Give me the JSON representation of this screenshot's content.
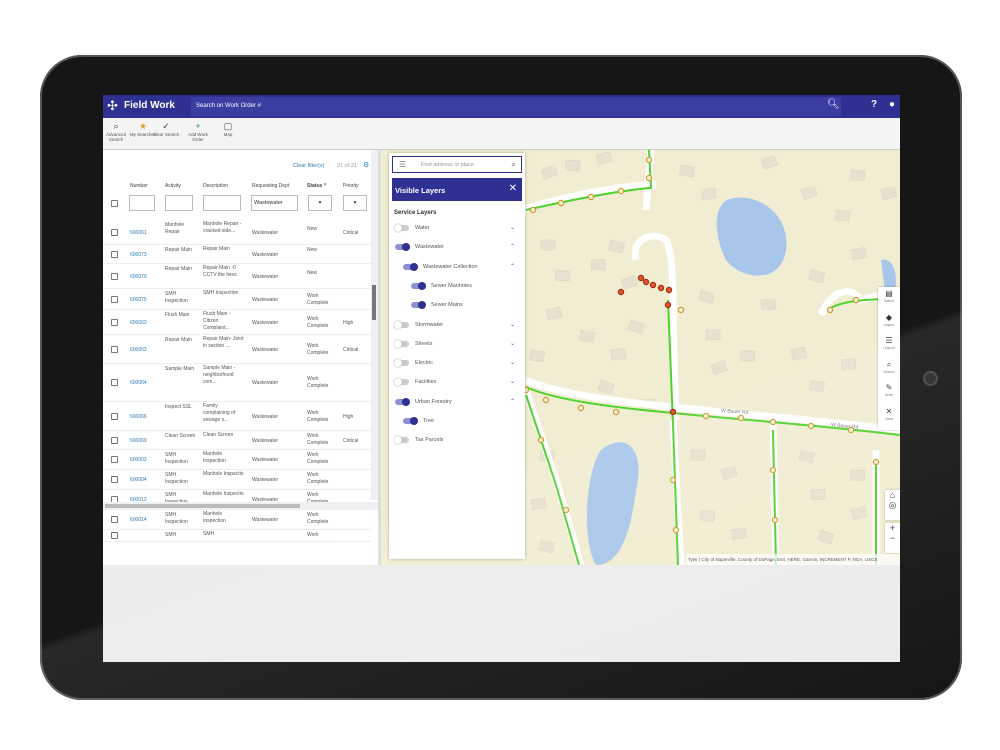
{
  "app": {
    "title": "Field Work",
    "search_placeholder": "Search on Work Order #"
  },
  "toolbar": [
    {
      "label": "Advanced Search",
      "icon": "magnifier-icon"
    },
    {
      "label": "My Searches",
      "icon": "star-icon"
    },
    {
      "label": "Clear Search",
      "icon": "broom-icon"
    },
    {
      "label": "Add Work Order",
      "icon": "plus-icon"
    },
    {
      "label": "Map",
      "icon": "map-icon"
    }
  ],
  "list": {
    "clear_filters": "Clear filter(s)",
    "count": "21 of 21",
    "columns": [
      "Number",
      "Activity",
      "Description",
      "Requesting Dept",
      "Status ^",
      "Priority"
    ],
    "filters": {
      "requesting_dept": "Wastewater"
    },
    "rows": [
      {
        "number": "600061",
        "activity": "Manhole Repair",
        "description": "Manhole Repair - cracked side...",
        "dept": "Wastewater",
        "status": "New",
        "priority": "Critical"
      },
      {
        "number": "600073",
        "activity": "Repair Main",
        "description": "Repair Main",
        "dept": "Wastewater",
        "status": "New",
        "priority": ""
      },
      {
        "number": "600079",
        "activity": "Repair Main",
        "description": "Repair Main -0 CCTV the lines",
        "dept": "Wastewater",
        "status": "New",
        "priority": ""
      },
      {
        "number": "600075",
        "activity": "SMH Inspection",
        "description": "SMH Inspection",
        "dept": "Wastewater",
        "status": "Work Complete",
        "priority": ""
      },
      {
        "number": "600062",
        "activity": "Flush Main",
        "description": "Flush Main - Citizen Complaint...",
        "dept": "Wastewater",
        "status": "Work Complete",
        "priority": "High"
      },
      {
        "number": "600063",
        "activity": "Repair Main",
        "description": "Repair Main- Joint in section ...",
        "dept": "Wastewater",
        "status": "Work Complete",
        "priority": "Critical"
      },
      {
        "number": "600064",
        "activity": "Sample Main",
        "description": "Sample Main - neighborhood com...",
        "dept": "Wastewater",
        "status": "Work Complete",
        "priority": ""
      },
      {
        "number": "600066",
        "activity": "Inspect SSL",
        "description": "Family complaining of sewage s...",
        "dept": "Wastewater",
        "status": "Work Complete",
        "priority": "High"
      },
      {
        "number": "600069",
        "activity": "Clean Screen",
        "description": "Clean Screen",
        "dept": "Wastewater",
        "status": "Work Complete",
        "priority": "Critical"
      },
      {
        "number": "600003",
        "activity": "SMH Inspection",
        "description": "Manhole Inspection",
        "dept": "Wastewater",
        "status": "Work Complete",
        "priority": ""
      },
      {
        "number": "600004",
        "activity": "SMH Inspection",
        "description": "Manhole Inspectio",
        "dept": "Wastewater",
        "status": "Work Complete",
        "priority": ""
      },
      {
        "number": "600012",
        "activity": "SMH Inspection",
        "description": "Manhole Inspectio",
        "dept": "Wastewater",
        "status": "Work Complete",
        "priority": ""
      },
      {
        "number": "600014",
        "activity": "SMH Inspection",
        "description": "Manhole Inspection",
        "dept": "Wastewater",
        "status": "Work Complete",
        "priority": ""
      },
      {
        "number": "",
        "activity": "SMH",
        "description": "SMH",
        "dept": "",
        "status": "Work",
        "priority": ""
      }
    ]
  },
  "layers": {
    "search_placeholder": "Find address or place",
    "title": "Visible Layers",
    "section": "Service Layers",
    "items": [
      {
        "label": "Water",
        "on": false,
        "level": 0,
        "chevron": "down"
      },
      {
        "label": "Wastewater",
        "on": true,
        "level": 0,
        "chevron": "up"
      },
      {
        "label": "Wastewater Collection",
        "on": true,
        "level": 1,
        "chevron": "up"
      },
      {
        "label": "Sewer Manholes",
        "on": true,
        "level": 2,
        "chevron": ""
      },
      {
        "label": "Sewer Mains",
        "on": true,
        "level": 2,
        "chevron": ""
      },
      {
        "label": "Stormwater",
        "on": false,
        "level": 0,
        "chevron": "down"
      },
      {
        "label": "Streets",
        "on": false,
        "level": 0,
        "chevron": "down"
      },
      {
        "label": "Electric",
        "on": false,
        "level": 0,
        "chevron": "down"
      },
      {
        "label": "Facilities",
        "on": false,
        "level": 0,
        "chevron": "down"
      },
      {
        "label": "Urban Forestry",
        "on": true,
        "level": 0,
        "chevron": "up"
      },
      {
        "label": "Tree",
        "on": true,
        "level": 1,
        "chevron": ""
      },
      {
        "label": "Tax Parcels",
        "on": false,
        "level": 0,
        "chevron": ""
      }
    ]
  },
  "map_tools": [
    {
      "label": "Select",
      "icon": "select-icon"
    },
    {
      "label": "Layers",
      "icon": "layers-icon"
    },
    {
      "label": "Legend",
      "icon": "legend-icon"
    },
    {
      "label": "Search",
      "icon": "search-icon"
    },
    {
      "label": "Draw",
      "icon": "pen-icon"
    },
    {
      "label": "Clear",
      "icon": "close-icon"
    }
  ],
  "map": {
    "street_labels": [
      "W Bauer Rd",
      "W Bauer Rd"
    ],
    "attribution": "Tyler | City of Naperville, County of DuPage, Esri, HERE, Garmin, INCREMENT P, NGA, USGS"
  },
  "colors": {
    "brand": "#2e3192",
    "sewer_main": "#4fd22e",
    "manhole": "#c8a030",
    "selected": "#e0562a",
    "link": "#2a7ab8"
  }
}
